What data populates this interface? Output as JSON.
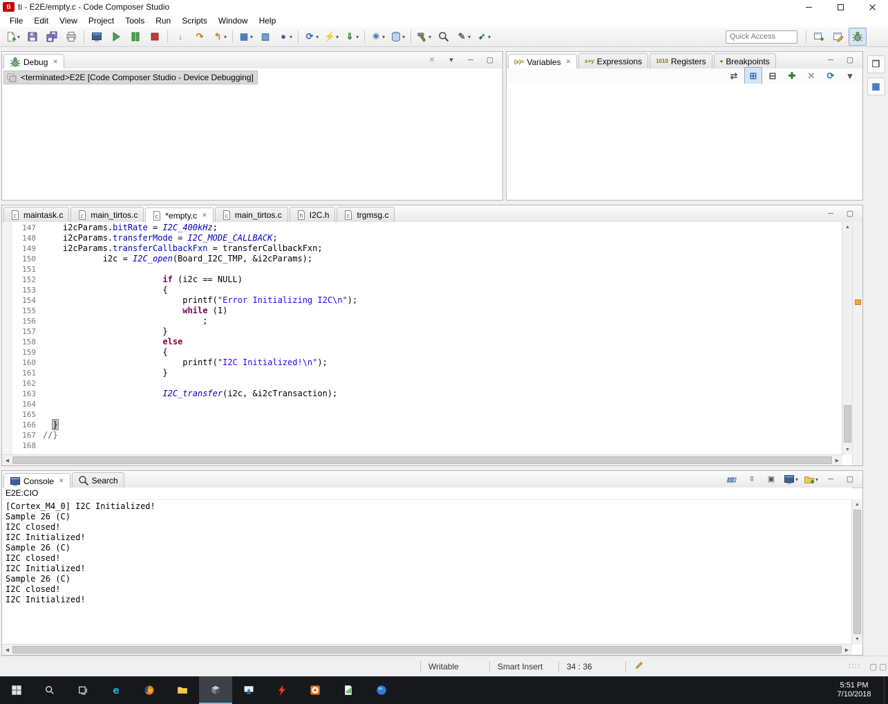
{
  "window": {
    "title": "ti - E2E/empty.c - Code Composer Studio",
    "logo": "ti"
  },
  "menubar": [
    "File",
    "Edit",
    "View",
    "Project",
    "Tools",
    "Run",
    "Scripts",
    "Window",
    "Help"
  ],
  "toolbar": {
    "quick_access_placeholder": "Quick Access",
    "buttons": [
      {
        "name": "new",
        "svg": "doc-new",
        "dd": true
      },
      {
        "name": "save",
        "svg": "floppy"
      },
      {
        "name": "save-all",
        "svg": "floppy-all"
      },
      {
        "name": "print",
        "svg": "printer"
      },
      {
        "sep": true
      },
      {
        "name": "view-console",
        "svg": "console"
      },
      {
        "name": "resume",
        "svg": "resume"
      },
      {
        "name": "suspend",
        "svg": "suspend"
      },
      {
        "name": "terminate",
        "svg": "terminate"
      },
      {
        "sep": true
      },
      {
        "name": "step-into",
        "glyph": "↓",
        "color": "#c08a00"
      },
      {
        "name": "step-over",
        "glyph": "↷",
        "color": "#c08a00"
      },
      {
        "name": "step-return",
        "glyph": "↰",
        "color": "#c08a00",
        "dd": true
      },
      {
        "sep": true
      },
      {
        "name": "memory-browser",
        "glyph": "▦",
        "color": "#3a6fb5",
        "dd": true
      },
      {
        "name": "registers-view",
        "glyph": "▥",
        "color": "#3a6fb5"
      },
      {
        "name": "breakpoint-toggle",
        "glyph": "●",
        "color": "#2f5fae",
        "dd": true
      },
      {
        "sep": true
      },
      {
        "name": "refresh-target",
        "glyph": "⟳",
        "color": "#3a6fb5",
        "dd": true
      },
      {
        "name": "flash-device",
        "glyph": "⚡",
        "color": "#c08a00",
        "dd": true
      },
      {
        "name": "load-program",
        "glyph": "⇓",
        "color": "#2d7d2d",
        "dd": true
      },
      {
        "sep": true
      },
      {
        "name": "new-target-configuration",
        "glyph": "✳",
        "color": "#3a6fb5",
        "dd": true
      },
      {
        "name": "target-configurations",
        "svg": "db",
        "dd": true
      },
      {
        "sep": true
      },
      {
        "name": "build",
        "svg": "hammer",
        "dd": true
      },
      {
        "name": "search",
        "svg": "search"
      },
      {
        "name": "annotation",
        "glyph": "✎",
        "color": "#666",
        "dd": true
      },
      {
        "name": "open-element",
        "glyph": "➶",
        "color": "#2d7d2d",
        "dd": true
      }
    ],
    "perspectives": [
      {
        "name": "open-perspective",
        "svg": "window-new"
      },
      {
        "name": "ccs-edit-perspective",
        "svg": "window-pencil"
      },
      {
        "name": "ccs-debug-perspective",
        "svg": "bug",
        "active": true
      }
    ]
  },
  "debug_panel": {
    "tab": "Debug",
    "item": "<terminated>E2E [Code Composer Studio - Device Debugging]",
    "header_icons": [
      {
        "name": "remove-all-terminated",
        "glyph": "✕",
        "color": "#9a9a9a"
      },
      {
        "name": "view-menu",
        "glyph": "▾",
        "color": "#555"
      },
      {
        "name": "minimize",
        "glyph": "─",
        "color": "#555"
      },
      {
        "name": "maximize",
        "glyph": "▢",
        "color": "#555"
      }
    ]
  },
  "variables_panel": {
    "tabs": [
      {
        "icon": "(x)=",
        "label": "Variables",
        "active": true,
        "close": true
      },
      {
        "icon": "x+y",
        "label": "Expressions"
      },
      {
        "icon": "1010",
        "label": "Registers"
      },
      {
        "icon": "●",
        "label": "Breakpoints"
      }
    ],
    "toolbar": [
      {
        "name": "show-type-names",
        "glyph": "⇄",
        "color": "#555"
      },
      {
        "name": "show-logical-structure",
        "glyph": "⊞",
        "color": "#3a6fb5",
        "active": true
      },
      {
        "name": "collapse-all",
        "glyph": "⊟",
        "color": "#555"
      },
      {
        "name": "new-watch-expression",
        "glyph": "✚",
        "color": "#2d7d2d"
      },
      {
        "name": "remove-selected",
        "glyph": "✕",
        "color": "#9a9a9a"
      },
      {
        "name": "refresh-views",
        "glyph": "⟳",
        "color": "#3a6fb5"
      },
      {
        "name": "view-menu",
        "glyph": "▾",
        "color": "#555"
      }
    ],
    "window_icons": [
      {
        "name": "minimize",
        "glyph": "─",
        "color": "#555"
      },
      {
        "name": "maximize",
        "glyph": "▢",
        "color": "#555"
      }
    ]
  },
  "editor": {
    "tabs": [
      {
        "label": "maintask.c"
      },
      {
        "label": "main_tirtos.c"
      },
      {
        "label": "*empty.c",
        "active": true,
        "close": true
      },
      {
        "label": "main_tirtos.c"
      },
      {
        "label": "I2C.h"
      },
      {
        "label": "trgmsg.c"
      }
    ],
    "window_icons": [
      {
        "name": "minimize",
        "glyph": "─",
        "color": "#555"
      },
      {
        "name": "maximize",
        "glyph": "▢",
        "color": "#555"
      }
    ],
    "lines": [
      {
        "n": 147,
        "t": [
          [
            "    i2cParams."
          ],
          [
            "bitRate",
            "f"
          ],
          [
            " = "
          ],
          [
            "I2C_400kHz",
            "m"
          ],
          [
            ";"
          ]
        ]
      },
      {
        "n": 148,
        "t": [
          [
            "    i2cParams."
          ],
          [
            "transferMode",
            "f"
          ],
          [
            " = "
          ],
          [
            "I2C_MODE_CALLBACK",
            "m"
          ],
          [
            ";"
          ]
        ]
      },
      {
        "n": 149,
        "t": [
          [
            "    i2cParams."
          ],
          [
            "transferCallbackFxn",
            "f"
          ],
          [
            " = transferCallbackFxn;"
          ]
        ]
      },
      {
        "n": 150,
        "t": [
          [
            "            i2c = "
          ],
          [
            "I2C_open",
            "m"
          ],
          [
            "(Board_I2C_TMP, &i2cParams);"
          ]
        ]
      },
      {
        "n": 151,
        "t": []
      },
      {
        "n": 152,
        "t": [
          [
            "                        "
          ],
          [
            "if",
            "k"
          ],
          [
            " (i2c == NULL)"
          ]
        ]
      },
      {
        "n": 153,
        "t": [
          [
            "                        {"
          ]
        ]
      },
      {
        "n": 154,
        "t": [
          [
            "                            printf("
          ],
          [
            "\"Error Initializing I2C\\n\"",
            "s"
          ],
          [
            ");"
          ]
        ]
      },
      {
        "n": 155,
        "t": [
          [
            "                            "
          ],
          [
            "while",
            "k"
          ],
          [
            " (1)"
          ]
        ]
      },
      {
        "n": 156,
        "t": [
          [
            "                                ;"
          ]
        ]
      },
      {
        "n": 157,
        "t": [
          [
            "                        }"
          ]
        ]
      },
      {
        "n": 158,
        "t": [
          [
            "                        "
          ],
          [
            "else",
            "k"
          ]
        ]
      },
      {
        "n": 159,
        "t": [
          [
            "                        {"
          ]
        ]
      },
      {
        "n": 160,
        "t": [
          [
            "                            printf("
          ],
          [
            "\"I2C Initialized!\\n\"",
            "s"
          ],
          [
            ");"
          ]
        ]
      },
      {
        "n": 161,
        "t": [
          [
            "                        }"
          ]
        ]
      },
      {
        "n": 162,
        "t": []
      },
      {
        "n": 163,
        "t": [
          [
            "                        "
          ],
          [
            "I2C_transfer",
            "m"
          ],
          [
            "(i2c, &i2cTransaction);"
          ]
        ]
      },
      {
        "n": 164,
        "t": []
      },
      {
        "n": 165,
        "t": []
      },
      {
        "n": 166,
        "t": [
          [
            "  "
          ],
          [
            "}",
            "cur"
          ]
        ]
      },
      {
        "n": 167,
        "t": [
          [
            "//}",
            "c"
          ]
        ]
      },
      {
        "n": 168,
        "t": []
      }
    ]
  },
  "console_panel": {
    "tabs": [
      {
        "label": "Console",
        "svg": "console",
        "active": true,
        "close": true
      },
      {
        "label": "Search",
        "svg": "search"
      }
    ],
    "title": "E2E:CIO",
    "toolbar": [
      {
        "name": "clear-console",
        "svg": "eraser"
      },
      {
        "name": "scroll-lock",
        "glyph": "⇳",
        "color": "#555"
      },
      {
        "name": "pin-console",
        "glyph": "▣",
        "color": "#555"
      },
      {
        "name": "display-selected-console",
        "svg": "console",
        "dd": true
      },
      {
        "name": "open-console",
        "svg": "folder-plus",
        "dd": true
      },
      {
        "name": "minimize",
        "glyph": "─",
        "color": "#555"
      },
      {
        "name": "maximize",
        "glyph": "▢",
        "color": "#555"
      }
    ],
    "lines": [
      "[Cortex_M4_0] I2C Initialized!",
      "Sample 26 (C)",
      "I2C closed!",
      "I2C Initialized!",
      "Sample 26 (C)",
      "I2C closed!",
      "I2C Initialized!",
      "Sample 26 (C)",
      "I2C closed!",
      "I2C Initialized!"
    ]
  },
  "statusbar": {
    "writable": "Writable",
    "insert_mode": "Smart Insert",
    "cursor_position": "34 : 36"
  },
  "right_trim": [
    {
      "name": "restore-view",
      "glyph": "❐",
      "color": "#555"
    },
    {
      "name": "memory-fastview",
      "glyph": "▦",
      "color": "#3a6fb5"
    }
  ],
  "taskbar": {
    "time": "5:51 PM",
    "date": "7/10/2018",
    "items": [
      {
        "name": "start",
        "svg": "win"
      },
      {
        "name": "search",
        "svg": "search-ring"
      },
      {
        "name": "task-view",
        "svg": "taskview"
      },
      {
        "name": "edge",
        "svg": "edge"
      },
      {
        "name": "firefox",
        "svg": "firefox"
      },
      {
        "name": "file-explorer",
        "svg": "folder"
      },
      {
        "name": "code-composer-studio",
        "svg": "cube",
        "active": true
      },
      {
        "name": "remote-pc-app",
        "svg": "pc-user"
      },
      {
        "name": "lightning-app",
        "svg": "bolt"
      },
      {
        "name": "orange-app",
        "svg": "orange-app"
      },
      {
        "name": "spreadsheet-app",
        "svg": "page-chart"
      },
      {
        "name": "blue-sphere-app",
        "svg": "sphere"
      }
    ]
  }
}
